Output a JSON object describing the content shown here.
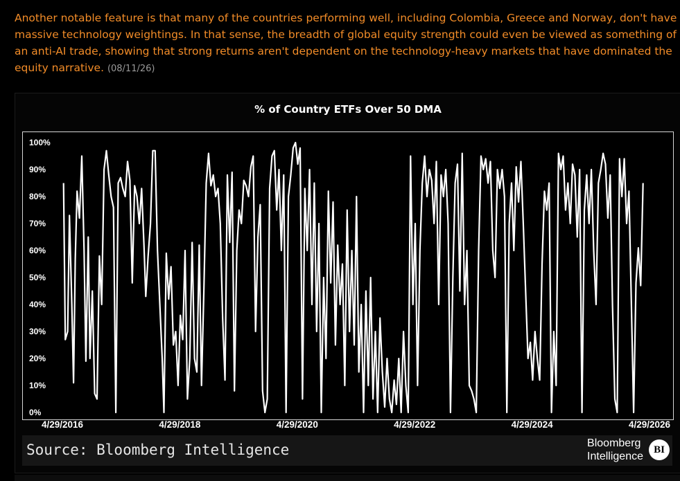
{
  "article": {
    "line1": "Another notable feature is that many of the countries performing well, including Colombia, Greece and Norway, don't have",
    "line2": "massive technology weightings. In that sense, the breadth of global equity strength could even be viewed as something of",
    "line3": "an anti-AI trade, showing that strong returns aren't dependent on the technology-heavy markets that have dominated the",
    "line4": "equity narrative.",
    "date": "(08/11/26)"
  },
  "chart": {
    "title": "% of Country ETFs Over 50 DMA",
    "source": "Source: Bloomberg Intelligence",
    "logo_line1": "Bloomberg",
    "logo_line2": "Intelligence",
    "badge": "BI"
  },
  "colors": {
    "text_accent": "#f28c28",
    "line": "#ffffff",
    "background": "#000000"
  },
  "chart_data": {
    "type": "line",
    "title": "% of Country ETFs Over 50 DMA",
    "xlabel": "",
    "ylabel": "",
    "ylim": [
      0,
      100
    ],
    "xlim": [
      "4/29/2016",
      "4/29/2026"
    ],
    "y_ticks": [
      "0%",
      "10%",
      "20%",
      "30%",
      "40%",
      "50%",
      "60%",
      "70%",
      "80%",
      "90%",
      "100%"
    ],
    "x_ticks": [
      "4/29/2016",
      "4/29/2018",
      "4/29/2020",
      "4/29/2022",
      "4/29/2024",
      "4/29/2026"
    ],
    "grid": false,
    "series": [
      {
        "values": [
          {
            "x": 2016.35,
            "y": 85
          },
          {
            "x": 2016.38,
            "y": 27
          },
          {
            "x": 2016.42,
            "y": 30
          },
          {
            "x": 2016.45,
            "y": 73
          },
          {
            "x": 2016.49,
            "y": 40
          },
          {
            "x": 2016.52,
            "y": 11
          },
          {
            "x": 2016.55,
            "y": 57
          },
          {
            "x": 2016.58,
            "y": 82
          },
          {
            "x": 2016.62,
            "y": 72
          },
          {
            "x": 2016.66,
            "y": 95
          },
          {
            "x": 2016.7,
            "y": 60
          },
          {
            "x": 2016.73,
            "y": 19
          },
          {
            "x": 2016.77,
            "y": 65
          },
          {
            "x": 2016.8,
            "y": 20
          },
          {
            "x": 2016.84,
            "y": 45
          },
          {
            "x": 2016.88,
            "y": 7
          },
          {
            "x": 2016.92,
            "y": 5
          },
          {
            "x": 2016.96,
            "y": 58
          },
          {
            "x": 2017.0,
            "y": 40
          },
          {
            "x": 2017.04,
            "y": 90
          },
          {
            "x": 2017.08,
            "y": 97
          },
          {
            "x": 2017.12,
            "y": 88
          },
          {
            "x": 2017.16,
            "y": 80
          },
          {
            "x": 2017.2,
            "y": 76
          },
          {
            "x": 2017.24,
            "y": 0
          },
          {
            "x": 2017.28,
            "y": 85
          },
          {
            "x": 2017.32,
            "y": 87
          },
          {
            "x": 2017.36,
            "y": 83
          },
          {
            "x": 2017.4,
            "y": 80
          },
          {
            "x": 2017.44,
            "y": 93
          },
          {
            "x": 2017.48,
            "y": 86
          },
          {
            "x": 2017.52,
            "y": 48
          },
          {
            "x": 2017.56,
            "y": 84
          },
          {
            "x": 2017.6,
            "y": 80
          },
          {
            "x": 2017.64,
            "y": 70
          },
          {
            "x": 2017.68,
            "y": 83
          },
          {
            "x": 2017.72,
            "y": 62
          },
          {
            "x": 2017.75,
            "y": 43
          },
          {
            "x": 2017.79,
            "y": 58
          },
          {
            "x": 2017.83,
            "y": 70
          },
          {
            "x": 2017.87,
            "y": 97
          },
          {
            "x": 2017.91,
            "y": 97
          },
          {
            "x": 2017.95,
            "y": 60
          },
          {
            "x": 2017.99,
            "y": 40
          },
          {
            "x": 2018.03,
            "y": 20
          },
          {
            "x": 2018.06,
            "y": 0
          },
          {
            "x": 2018.1,
            "y": 59
          },
          {
            "x": 2018.14,
            "y": 42
          },
          {
            "x": 2018.18,
            "y": 54
          },
          {
            "x": 2018.22,
            "y": 25
          },
          {
            "x": 2018.26,
            "y": 30
          },
          {
            "x": 2018.3,
            "y": 10
          },
          {
            "x": 2018.34,
            "y": 36
          },
          {
            "x": 2018.38,
            "y": 27
          },
          {
            "x": 2018.42,
            "y": 60
          },
          {
            "x": 2018.46,
            "y": 5
          },
          {
            "x": 2018.5,
            "y": 20
          },
          {
            "x": 2018.54,
            "y": 63
          },
          {
            "x": 2018.58,
            "y": 20
          },
          {
            "x": 2018.62,
            "y": 15
          },
          {
            "x": 2018.66,
            "y": 62
          },
          {
            "x": 2018.7,
            "y": 10
          },
          {
            "x": 2018.74,
            "y": 45
          },
          {
            "x": 2018.78,
            "y": 85
          },
          {
            "x": 2018.82,
            "y": 96
          },
          {
            "x": 2018.86,
            "y": 84
          },
          {
            "x": 2018.9,
            "y": 88
          },
          {
            "x": 2018.94,
            "y": 80
          },
          {
            "x": 2018.98,
            "y": 83
          },
          {
            "x": 2019.02,
            "y": 70
          },
          {
            "x": 2019.06,
            "y": 35
          },
          {
            "x": 2019.1,
            "y": 12
          },
          {
            "x": 2019.14,
            "y": 88
          },
          {
            "x": 2019.18,
            "y": 63
          },
          {
            "x": 2019.22,
            "y": 89
          },
          {
            "x": 2019.26,
            "y": 8
          },
          {
            "x": 2019.3,
            "y": 60
          },
          {
            "x": 2019.34,
            "y": 75
          },
          {
            "x": 2019.38,
            "y": 70
          },
          {
            "x": 2019.42,
            "y": 86
          },
          {
            "x": 2019.46,
            "y": 84
          },
          {
            "x": 2019.5,
            "y": 80
          },
          {
            "x": 2019.54,
            "y": 91
          },
          {
            "x": 2019.58,
            "y": 95
          },
          {
            "x": 2019.62,
            "y": 30
          },
          {
            "x": 2019.66,
            "y": 65
          },
          {
            "x": 2019.7,
            "y": 77
          },
          {
            "x": 2019.74,
            "y": 8
          },
          {
            "x": 2019.78,
            "y": 0
          },
          {
            "x": 2019.82,
            "y": 5
          },
          {
            "x": 2019.86,
            "y": 83
          },
          {
            "x": 2019.9,
            "y": 95
          },
          {
            "x": 2019.94,
            "y": 97
          },
          {
            "x": 2019.98,
            "y": 75
          },
          {
            "x": 2020.02,
            "y": 90
          },
          {
            "x": 2020.06,
            "y": 60
          },
          {
            "x": 2020.1,
            "y": 88
          },
          {
            "x": 2020.14,
            "y": 0
          },
          {
            "x": 2020.18,
            "y": 80
          },
          {
            "x": 2020.22,
            "y": 88
          },
          {
            "x": 2020.26,
            "y": 98
          },
          {
            "x": 2020.3,
            "y": 100
          },
          {
            "x": 2020.34,
            "y": 92
          },
          {
            "x": 2020.38,
            "y": 98
          },
          {
            "x": 2020.42,
            "y": 5
          },
          {
            "x": 2020.46,
            "y": 83
          },
          {
            "x": 2020.5,
            "y": 60
          },
          {
            "x": 2020.54,
            "y": 90
          },
          {
            "x": 2020.58,
            "y": 40
          },
          {
            "x": 2020.62,
            "y": 85
          },
          {
            "x": 2020.66,
            "y": 30
          },
          {
            "x": 2020.7,
            "y": 70
          },
          {
            "x": 2020.74,
            "y": 0
          },
          {
            "x": 2020.78,
            "y": 50
          },
          {
            "x": 2020.82,
            "y": 20
          },
          {
            "x": 2020.86,
            "y": 82
          },
          {
            "x": 2020.9,
            "y": 48
          },
          {
            "x": 2020.94,
            "y": 78
          },
          {
            "x": 2020.98,
            "y": 25
          },
          {
            "x": 2021.02,
            "y": 62
          },
          {
            "x": 2021.06,
            "y": 40
          },
          {
            "x": 2021.1,
            "y": 55
          },
          {
            "x": 2021.14,
            "y": 10
          },
          {
            "x": 2021.18,
            "y": 75
          },
          {
            "x": 2021.22,
            "y": 30
          },
          {
            "x": 2021.26,
            "y": 60
          },
          {
            "x": 2021.3,
            "y": 25
          },
          {
            "x": 2021.34,
            "y": 80
          },
          {
            "x": 2021.38,
            "y": 15
          },
          {
            "x": 2021.42,
            "y": 40
          },
          {
            "x": 2021.46,
            "y": 0
          },
          {
            "x": 2021.5,
            "y": 45
          },
          {
            "x": 2021.54,
            "y": 10
          },
          {
            "x": 2021.58,
            "y": 50
          },
          {
            "x": 2021.62,
            "y": 5
          },
          {
            "x": 2021.66,
            "y": 30
          },
          {
            "x": 2021.7,
            "y": 0
          },
          {
            "x": 2021.74,
            "y": 35
          },
          {
            "x": 2021.78,
            "y": 15
          },
          {
            "x": 2021.82,
            "y": 2
          },
          {
            "x": 2021.86,
            "y": 20
          },
          {
            "x": 2021.9,
            "y": 5
          },
          {
            "x": 2021.94,
            "y": 0
          },
          {
            "x": 2021.98,
            "y": 12
          },
          {
            "x": 2022.02,
            "y": 3
          },
          {
            "x": 2022.06,
            "y": 20
          },
          {
            "x": 2022.1,
            "y": 0
          },
          {
            "x": 2022.14,
            "y": 30
          },
          {
            "x": 2022.18,
            "y": 10
          },
          {
            "x": 2022.22,
            "y": 0
          },
          {
            "x": 2022.26,
            "y": 95
          },
          {
            "x": 2022.3,
            "y": 40
          },
          {
            "x": 2022.34,
            "y": 70
          },
          {
            "x": 2022.38,
            "y": 10
          },
          {
            "x": 2022.42,
            "y": 60
          },
          {
            "x": 2022.46,
            "y": 85
          },
          {
            "x": 2022.5,
            "y": 95
          },
          {
            "x": 2022.54,
            "y": 80
          },
          {
            "x": 2022.58,
            "y": 90
          },
          {
            "x": 2022.62,
            "y": 86
          },
          {
            "x": 2022.66,
            "y": 70
          },
          {
            "x": 2022.7,
            "y": 93
          },
          {
            "x": 2022.74,
            "y": 40
          },
          {
            "x": 2022.78,
            "y": 88
          },
          {
            "x": 2022.82,
            "y": 80
          },
          {
            "x": 2022.86,
            "y": 90
          },
          {
            "x": 2022.9,
            "y": 70
          },
          {
            "x": 2022.94,
            "y": 0
          },
          {
            "x": 2022.98,
            "y": 50
          },
          {
            "x": 2023.02,
            "y": 85
          },
          {
            "x": 2023.06,
            "y": 92
          },
          {
            "x": 2023.1,
            "y": 45
          },
          {
            "x": 2023.14,
            "y": 96
          },
          {
            "x": 2023.18,
            "y": 40
          },
          {
            "x": 2023.22,
            "y": 60
          },
          {
            "x": 2023.26,
            "y": 10
          },
          {
            "x": 2023.3,
            "y": 8
          },
          {
            "x": 2023.34,
            "y": 5
          },
          {
            "x": 2023.38,
            "y": 0
          },
          {
            "x": 2023.42,
            "y": 60
          },
          {
            "x": 2023.46,
            "y": 95
          },
          {
            "x": 2023.5,
            "y": 90
          },
          {
            "x": 2023.54,
            "y": 94
          },
          {
            "x": 2023.58,
            "y": 85
          },
          {
            "x": 2023.62,
            "y": 93
          },
          {
            "x": 2023.66,
            "y": 60
          },
          {
            "x": 2023.7,
            "y": 50
          },
          {
            "x": 2023.74,
            "y": 90
          },
          {
            "x": 2023.78,
            "y": 83
          },
          {
            "x": 2023.82,
            "y": 90
          },
          {
            "x": 2023.86,
            "y": 80
          },
          {
            "x": 2023.9,
            "y": 0
          },
          {
            "x": 2023.94,
            "y": 70
          },
          {
            "x": 2023.98,
            "y": 85
          },
          {
            "x": 2024.02,
            "y": 60
          },
          {
            "x": 2024.06,
            "y": 91
          },
          {
            "x": 2024.1,
            "y": 78
          },
          {
            "x": 2024.14,
            "y": 93
          },
          {
            "x": 2024.18,
            "y": 70
          },
          {
            "x": 2024.22,
            "y": 45
          },
          {
            "x": 2024.26,
            "y": 20
          },
          {
            "x": 2024.3,
            "y": 26
          },
          {
            "x": 2024.34,
            "y": 12
          },
          {
            "x": 2024.38,
            "y": 30
          },
          {
            "x": 2024.42,
            "y": 20
          },
          {
            "x": 2024.46,
            "y": 12
          },
          {
            "x": 2024.5,
            "y": 55
          },
          {
            "x": 2024.54,
            "y": 82
          },
          {
            "x": 2024.58,
            "y": 75
          },
          {
            "x": 2024.62,
            "y": 85
          },
          {
            "x": 2024.66,
            "y": 0
          },
          {
            "x": 2024.7,
            "y": 30
          },
          {
            "x": 2024.74,
            "y": 10
          },
          {
            "x": 2024.78,
            "y": 96
          },
          {
            "x": 2024.82,
            "y": 90
          },
          {
            "x": 2024.86,
            "y": 95
          },
          {
            "x": 2024.9,
            "y": 75
          },
          {
            "x": 2024.94,
            "y": 85
          },
          {
            "x": 2024.98,
            "y": 70
          },
          {
            "x": 2025.02,
            "y": 92
          },
          {
            "x": 2025.06,
            "y": 88
          },
          {
            "x": 2025.1,
            "y": 65
          },
          {
            "x": 2025.14,
            "y": 90
          },
          {
            "x": 2025.18,
            "y": 0
          },
          {
            "x": 2025.22,
            "y": 75
          },
          {
            "x": 2025.26,
            "y": 88
          },
          {
            "x": 2025.3,
            "y": 70
          },
          {
            "x": 2025.34,
            "y": 90
          },
          {
            "x": 2025.38,
            "y": 60
          },
          {
            "x": 2025.42,
            "y": 40
          },
          {
            "x": 2025.46,
            "y": 85
          },
          {
            "x": 2025.5,
            "y": 90
          },
          {
            "x": 2025.54,
            "y": 96
          },
          {
            "x": 2025.58,
            "y": 92
          },
          {
            "x": 2025.62,
            "y": 72
          },
          {
            "x": 2025.66,
            "y": 88
          },
          {
            "x": 2025.7,
            "y": 40
          },
          {
            "x": 2025.74,
            "y": 5
          },
          {
            "x": 2025.78,
            "y": 0
          },
          {
            "x": 2025.82,
            "y": 94
          },
          {
            "x": 2025.86,
            "y": 80
          },
          {
            "x": 2025.9,
            "y": 94
          },
          {
            "x": 2025.94,
            "y": 70
          },
          {
            "x": 2025.98,
            "y": 82
          },
          {
            "x": 2026.02,
            "y": 42
          },
          {
            "x": 2026.06,
            "y": 0
          },
          {
            "x": 2026.1,
            "y": 48
          },
          {
            "x": 2026.14,
            "y": 61
          },
          {
            "x": 2026.18,
            "y": 47
          },
          {
            "x": 2026.22,
            "y": 85
          }
        ]
      }
    ]
  }
}
